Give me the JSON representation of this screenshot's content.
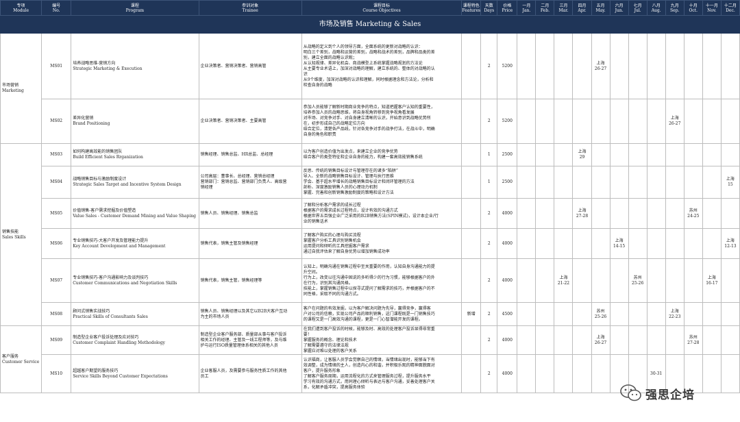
{
  "headers": {
    "module": [
      "专项",
      "Module"
    ],
    "code": [
      "编号",
      "No."
    ],
    "program": [
      "课程",
      "Program"
    ],
    "trainee": [
      "参训对象",
      "Trainee"
    ],
    "objectives": [
      "课程目标",
      "Course Objectives"
    ],
    "features": [
      "课程特色",
      "Features"
    ],
    "days": [
      "天数",
      "Days"
    ],
    "price": [
      "价格",
      "Price"
    ],
    "months": [
      [
        "一月",
        "Jan."
      ],
      [
        "二月",
        "Feb."
      ],
      [
        "三月",
        "Mar."
      ],
      [
        "四月",
        "Apr."
      ],
      [
        "五月",
        "May."
      ],
      [
        "六月",
        "Jun."
      ],
      [
        "七月",
        "Jul."
      ],
      [
        "八月",
        "Aug."
      ],
      [
        "九月",
        "Sep."
      ],
      [
        "十月",
        "Oct."
      ],
      [
        "十一月",
        "Nov."
      ],
      [
        "十二月",
        "Dec."
      ]
    ]
  },
  "section_title": "市场及销售 Marketing & Sales",
  "modules": [
    {
      "lines": [
        "市场营销",
        "Marketing"
      ],
      "rowspan": 2
    },
    {
      "lines": [
        "销售技能",
        "Sales Skills"
      ],
      "rowspan": 6
    },
    {
      "lines": [
        "客户服务",
        "Customer Service"
      ],
      "rowspan": 2
    }
  ],
  "courses": [
    {
      "code": "MS01",
      "title": [
        "培养战略思维-营销方向",
        "Strategic Marketing & Execution"
      ],
      "trainee": [
        "企业决策者、营销决策者、营销高管"
      ],
      "objectives": [
        "从战略的定义到个人的领导方面，全面系统的更新对战略的认识：",
        "明白三个差别，战略和运营的差别，战略和战术的差别，品牌和品类的差",
        "别，建立全面的战略认识观；",
        "从认知规律、差异化机会、商战模型上系统掌握战略规划的方法论",
        "从主要专业术语上，加深对战略的理解，建立系统的、整体的对战略的认",
        "识",
        "从9个维度，加深对战略的认识和理解，同时根据理念和方法论，分析和",
        "检查自身的战略"
      ],
      "features": "",
      "days": "2",
      "price": "5200",
      "schedule": {
        "5": [
          "上海",
          "26-27"
        ]
      }
    },
    {
      "code": "MS02",
      "title": [
        "差异化营销",
        "Brand Positioning"
      ],
      "trainee": [
        "企业决策者、营销决策者、主要高管"
      ],
      "objectives": [
        "参加人员能够了解新时期商业竞争的特点，知道把握客户认知的重要性，",
        "培养参加人员的战略思维，将自身视角转移到竞争视角看发展",
        "对市场、对竞争对手、对自身建立清晰的认识，开始意识到战略优势所",
        "在，初步形成自己的战略定位方向",
        "结合定位，清楚各产品线，针对各竞争对手的战争打法，在战斗中，明确",
        "自身的角色和职责"
      ],
      "features": "",
      "days": "2",
      "price": "5200",
      "schedule": {
        "9": [
          "上海",
          "26-27"
        ]
      }
    },
    {
      "code": "MS03",
      "title": [
        "如何构建高效能的销售团队",
        "Build Efficient Sales Rrganization"
      ],
      "trainee": [
        "销售经理、销售总监、HR总监、总经理"
      ],
      "objectives": [
        "以为客户创造价值为出发点，来建立企业的竞争优势",
        "结合客户的类型特征和企业自身的能力，构建一套高效能销售系统"
      ],
      "features": "",
      "days": "1",
      "price": "2500",
      "schedule": {
        "4": [
          "上海",
          "29"
        ]
      }
    },
    {
      "code": "MS04",
      "title": [
        "战略销售目标与激励制度设计",
        "Strategic Sales Target and Incentive System Design"
      ],
      "trainee": [
        "公司高层：董事长、总经理、营销总经理",
        "营销部门：营销总监、营销部门负责人、高级营",
        "销经理"
      ],
      "objectives": [
        "反思、传统的销售目标设计与管理存在的诸多“陷阱”",
        "导入、全新的战略销售目标设计、管理与执行思维",
        "学会、基于超水平增长的战略销售目标设计和闭环管理的方法",
        "剖析、深度激励销售人员的心理动力机制",
        "掌握、完善和创新销售激励制度的策略和设计方法"
      ],
      "features": "",
      "days": "1",
      "price": "2500",
      "schedule": {
        "12": [
          "上海",
          "15"
        ]
      }
    },
    {
      "code": "MS05",
      "title": [
        "价值销售-客户需求挖掘及价值塑造",
        "Value Sales - Customer Demand Mining and Value Shaping"
      ],
      "trainee": [
        "销售人员、销售经理、销售总监"
      ],
      "objectives": [
        "了解和分析客户需求的成长过程",
        "根据客户的需求成长过程特点，设计有效的沟通方式",
        "根据世界五百强企业广泛采用的B2B销售方法(SPIN模式)，设计本企业/行",
        "业的销售话术"
      ],
      "features": "",
      "days": "2",
      "price": "4000",
      "schedule": {
        "4": [
          "上海",
          "27-28"
        ],
        "10": [
          "苏州",
          "24-25"
        ]
      }
    },
    {
      "code": "MS06",
      "title": [
        "专业销售技巧-大客户开发及管理能力提升",
        "Key Account Development and Management"
      ],
      "trainee": [
        "销售代表，销售主管及销售经理"
      ],
      "objectives": [
        "了解客户购买的心理与购买流程",
        "掌握客户分析工具识别销售机会",
        "运用提问和倾听的工具挖掘客户需求",
        "通过自我评估来了解自身优势以增加销售成功率"
      ],
      "features": "",
      "days": "2",
      "price": "4000",
      "schedule": {
        "6": [
          "上海",
          "14-15"
        ],
        "12": [
          "上海",
          "12-13"
        ]
      }
    },
    {
      "code": "MS07",
      "title": [
        "专业销售技巧-客户沟通影响力及谈判技巧",
        "Customer Communications and Negotiation Skills"
      ],
      "trainee": [
        "销售代表，销售主管，销售经理等"
      ],
      "objectives": [
        "认知上，明确沟通在销售过程中至关重要的作用，认知自身沟通能力的提",
        "升空间。",
        "行为上，改变以往沟通中固说的多听得少的行为习惯，能够根据客户的外",
        "在行为，识别其沟通风格。",
        "技能上，掌握销售过程中以探寻式提问了解需求的技巧，并根据客户的不",
        "同性格，采取不同的沟通方式。"
      ],
      "features": "",
      "days": "2",
      "price": "4000",
      "schedule": {
        "3": [
          "上海",
          "21-22"
        ],
        "7": [
          "苏州",
          "25-26"
        ],
        "11": [
          "上海",
          "16-17"
        ]
      }
    },
    {
      "code": "MS08",
      "title": [
        "顾问式销售实战技巧",
        "Practical Skills of Consultants Sales"
      ],
      "trainee": [
        "销售人员、销售经理以及其它以B2B大客户互动",
        "为主的市场人员"
      ],
      "objectives": [
        "客户在问题的有效发掘，以为客户解决问题为先导，赢得竞争，赢得客",
        "户对公司的信赖，实现公司产品的顺利销售，这门课程既是一门销售技巧",
        "的课程又是一门高效沟通的课程，更是一门心智潜能开发的课程。"
      ],
      "features": "新增",
      "days": "2",
      "price": "4500",
      "schedule": {
        "5": [
          "苏州",
          "25-26"
        ],
        "9": [
          "上海",
          "22-23"
        ]
      }
    },
    {
      "code": "MS09",
      "title": [
        "制造型企业客户投诉处理及应对技巧",
        "Customer Complaint Handling Methodology"
      ],
      "trainee": [
        "制造型企业客户服务部、质量部从事与客户投诉",
        "相关工作的经理、主管及一线工程师等，及与维",
        "护与运行ISO质量管理体系相关的其他人员"
      ],
      "objectives": [
        "在我们遭到客户投诉的时候，能够及时、高效的处理客户投诉显得非常重",
        "要！",
        "掌握服务的概念、理论和技术",
        "了解需要遵守的法律法规",
        "掌握应对难以处理的客户关系"
      ],
      "features": "",
      "days": "2",
      "price": "4000",
      "schedule": {
        "5": [
          "上海",
          "26-27"
        ],
        "10": [
          "苏州",
          "27-28"
        ]
      }
    },
    {
      "code": "MS10",
      "title": [
        "超越客户期望的服务技巧",
        "Service Skills Beyond Customer Expectations"
      ],
      "trainee": [
        "企业客服人员，及需要参与服务性质工作的其他",
        "员工"
      ],
      "objectives": [
        "认识福商，让客服人员学会觉察自己的情绪，当情绪出现时，能够当下有",
        "效调整，成为情绪的主人，创造内心的和谐，并积极乐观的精神面貌面对",
        "客户，提升服务形象",
        "了解客户服务周期，运用流程化的方式来管理服务过程，提升服务水平",
        "学习有效的沟通方式，用同理心倾听与表达与客户沟通，妥善处理客户关",
        "系，化解矛盾冲突，提高服务体验"
      ],
      "features": "",
      "days": "2",
      "price": "4000",
      "schedule": {
        "8": [
          "",
          "30-31"
        ]
      }
    }
  ],
  "watermark": {
    "text": "强思企培",
    "icon": "wechat-icon"
  }
}
